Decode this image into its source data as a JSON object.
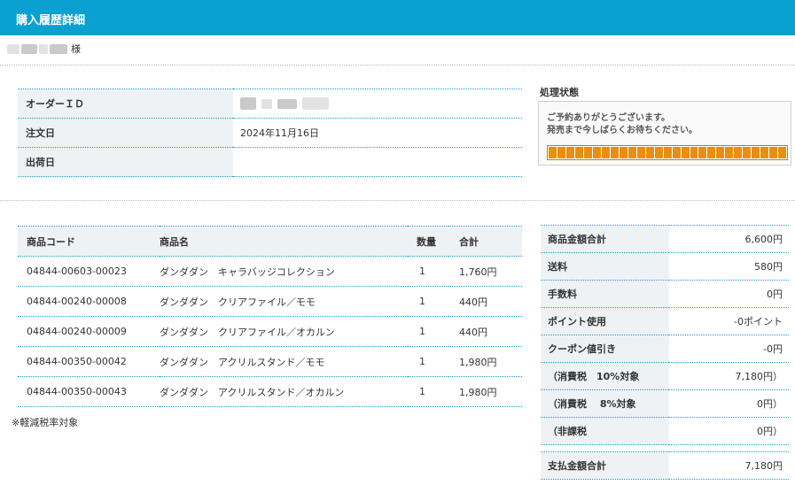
{
  "header": {
    "title": "購入履歴詳細"
  },
  "customer": {
    "honorific": "様"
  },
  "order_info": {
    "rows": [
      {
        "label": "オーダーＩＤ",
        "value": ""
      },
      {
        "label": "注文日",
        "value": "2024年11月16日"
      },
      {
        "label": "出荷日",
        "value": ""
      }
    ]
  },
  "status": {
    "title": "処理状態",
    "message_line1": "ご予約ありがとうございます。",
    "message_line2": "発売まで今しばらくお待ちください。",
    "progress": 1.0,
    "bar_color": "#e8900c"
  },
  "items": {
    "headers": {
      "code": "商品コード",
      "name": "商品名",
      "qty": "数量",
      "total": "合計"
    },
    "rows": [
      {
        "code": "04844-00603-00023",
        "name": "ダンダダン　キャラバッジコレクション",
        "qty": "1",
        "total": "1,760円"
      },
      {
        "code": "04844-00240-00008",
        "name": "ダンダダン　クリアファイル／モモ",
        "qty": "1",
        "total": "440円"
      },
      {
        "code": "04844-00240-00009",
        "name": "ダンダダン　クリアファイル／オカルン",
        "qty": "1",
        "total": "440円"
      },
      {
        "code": "04844-00350-00042",
        "name": "ダンダダン　アクリルスタンド／モモ",
        "qty": "1",
        "total": "1,980円"
      },
      {
        "code": "04844-00350-00043",
        "name": "ダンダダン　アクリルスタンド／オカルン",
        "qty": "1",
        "total": "1,980円"
      }
    ]
  },
  "tax_note": "※軽減税率対象",
  "summary": {
    "rows": [
      {
        "label": "商品金額合計",
        "value": "6,600円"
      },
      {
        "label": "送料",
        "value": "580円"
      },
      {
        "label": "手数料",
        "value": "0円"
      },
      {
        "label": "ポイント使用",
        "value": "-0ポイント"
      },
      {
        "label": "クーポン値引き",
        "value": "-0円"
      },
      {
        "label": "（消費税　10%対象",
        "value": "7,180円）"
      },
      {
        "label": "（消費税　 8%対象",
        "value": "0円）"
      },
      {
        "label": "（非課税",
        "value": "0円）"
      }
    ],
    "total_label": "支払金額合計",
    "total_value": "7,180円"
  },
  "colors": {
    "header_bg": "#0aa0d0",
    "accent_border": "#1a9ed0",
    "label_bg": "#eef2f5"
  }
}
